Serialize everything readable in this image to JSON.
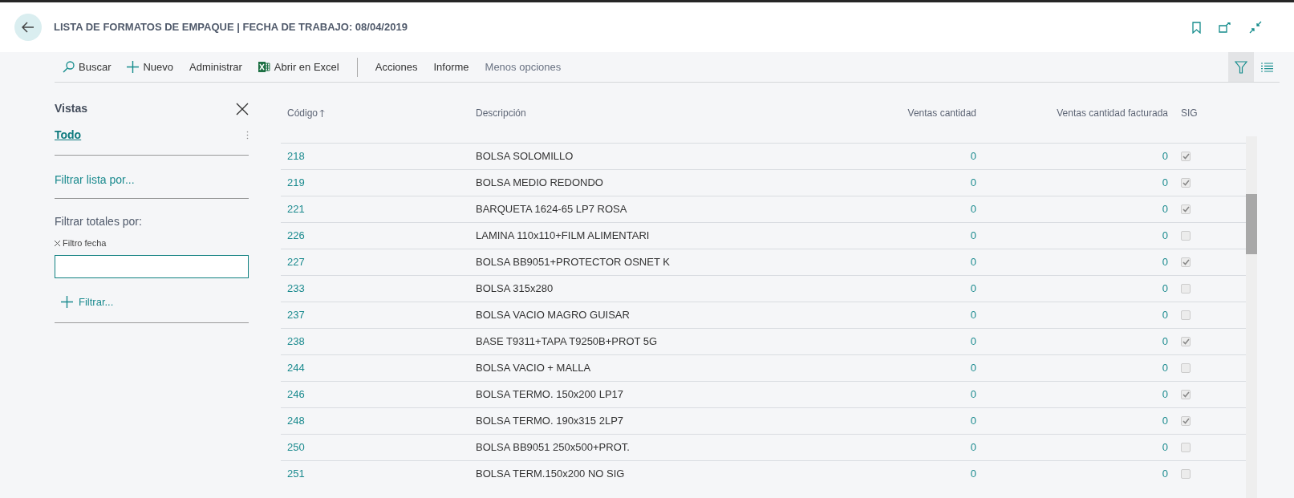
{
  "header": {
    "title": "LISTA DE FORMATOS DE EMPAQUE | FECHA DE TRABAJO: 08/04/2019"
  },
  "toolbar": {
    "actions": [
      {
        "kind": "search",
        "label": "Buscar"
      },
      {
        "kind": "new",
        "label": "Nuevo"
      },
      {
        "kind": "plain",
        "label": "Administrar"
      },
      {
        "kind": "excel",
        "label": "Abrir en Excel"
      },
      {
        "kind": "plain",
        "label": "Acciones",
        "separator_before": true
      },
      {
        "kind": "plain",
        "label": "Informe"
      },
      {
        "kind": "muted",
        "label": "Menos opciones"
      }
    ],
    "view_toggles": [
      {
        "kind": "filter",
        "selected": true
      },
      {
        "kind": "list",
        "selected": false
      }
    ]
  },
  "sidebar": {
    "title": "Vistas",
    "views": [
      {
        "label": "Todo",
        "selected": true
      }
    ],
    "filter_list_link": "Filtrar lista por...",
    "totals_title": "Filtrar totales por:",
    "date_filter": {
      "label": "Filtro fecha"
    },
    "add_filter": "Filtrar..."
  },
  "table": {
    "columns": [
      {
        "label": "Código",
        "sorted": true
      },
      {
        "label": "Descripción",
        "sorted": false
      },
      {
        "label": "Ventas cantidad",
        "sorted": false
      },
      {
        "label": "Ventas cantidad facturada",
        "sorted": false
      },
      {
        "label": "SIG",
        "sorted": false
      }
    ],
    "rows": [
      {
        "code": "218",
        "description": "BOLSA SOLOMILLO",
        "sales_qty": "0",
        "sales_invoiced": "0",
        "sig": true
      },
      {
        "code": "219",
        "description": "BOLSA MEDIO REDONDO",
        "sales_qty": "0",
        "sales_invoiced": "0",
        "sig": true
      },
      {
        "code": "221",
        "description": "BARQUETA 1624-65 LP7 ROSA",
        "sales_qty": "0",
        "sales_invoiced": "0",
        "sig": true
      },
      {
        "code": "226",
        "description": "LAMINA 110x110+FILM ALIMENTARI",
        "sales_qty": "0",
        "sales_invoiced": "0",
        "sig": false
      },
      {
        "code": "227",
        "description": "BOLSA BB9051+PROTECTOR OSNET K",
        "sales_qty": "0",
        "sales_invoiced": "0",
        "sig": true
      },
      {
        "code": "233",
        "description": "BOLSA 315x280",
        "sales_qty": "0",
        "sales_invoiced": "0",
        "sig": false
      },
      {
        "code": "237",
        "description": "BOLSA VACIO MAGRO GUISAR",
        "sales_qty": "0",
        "sales_invoiced": "0",
        "sig": false
      },
      {
        "code": "238",
        "description": "BASE T9311+TAPA T9250B+PROT 5G",
        "sales_qty": "0",
        "sales_invoiced": "0",
        "sig": true
      },
      {
        "code": "244",
        "description": "BOLSA VACIO + MALLA",
        "sales_qty": "0",
        "sales_invoiced": "0",
        "sig": false
      },
      {
        "code": "246",
        "description": "BOLSA TERMO. 150x200 LP17",
        "sales_qty": "0",
        "sales_invoiced": "0",
        "sig": true
      },
      {
        "code": "248",
        "description": "BOLSA TERMO. 190x315 2LP7",
        "sales_qty": "0",
        "sales_invoiced": "0",
        "sig": true
      },
      {
        "code": "250",
        "description": "BOLSA BB9051 250x500+PROT.",
        "sales_qty": "0",
        "sales_invoiced": "0",
        "sig": false
      },
      {
        "code": "251",
        "description": "BOLSA TERM.150x200 NO SIG",
        "sales_qty": "0",
        "sales_invoiced": "0",
        "sig": false
      }
    ]
  }
}
